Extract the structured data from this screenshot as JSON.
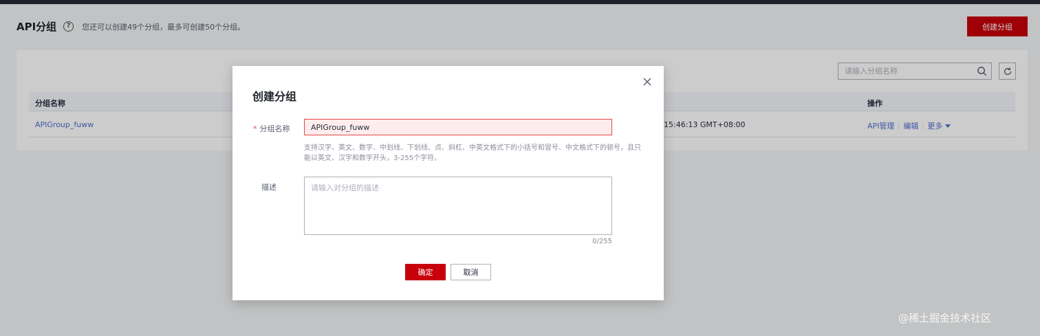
{
  "header": {
    "title": "API分组",
    "help_icon": "?",
    "tip": "您还可以创建49个分组，最多可创建50个分组。",
    "create_button": "创建分组"
  },
  "toolbar": {
    "search_placeholder": "请输入分组名称"
  },
  "table": {
    "columns": [
      "分组名称",
      "操作"
    ],
    "rows": [
      {
        "name": "APIGroup_fuww",
        "time": "15:46:13 GMT+08:00",
        "actions": [
          "API管理",
          "编辑",
          "更多"
        ]
      }
    ]
  },
  "dialog": {
    "title": "创建分组",
    "name_label": "分组名称",
    "required_mark": "*",
    "name_value": "APIGroup_fuww",
    "name_hint": "支持汉字、英文、数字、中划线、下划线、点、斜杠、中英文格式下的小括号和冒号、中文格式下的顿号，且只能以英文、汉字和数字开头，3-255个字符。",
    "desc_label": "描述",
    "desc_placeholder": "请输入对分组的描述",
    "desc_counter": "0/255",
    "ok_button": "确定",
    "cancel_button": "取消"
  },
  "watermark": "@稀土掘金技术社区",
  "colors": {
    "primary": "#c7000b",
    "link": "#526ecc",
    "error": "#e54545"
  }
}
